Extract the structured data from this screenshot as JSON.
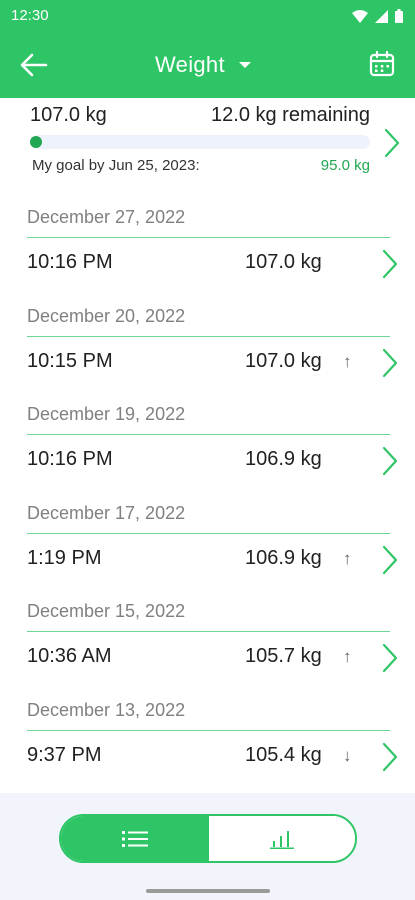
{
  "status_bar": {
    "time": "12:30"
  },
  "app_bar": {
    "title": "Weight"
  },
  "summary": {
    "current_weight": "107.0 kg",
    "remaining": "12.0 kg remaining",
    "goal_label": "My goal by  Jun 25, 2023:",
    "goal_weight": "95.0 kg",
    "progress_fraction": 0.0
  },
  "entries": [
    {
      "date": "December 27, 2022",
      "time": "10:16 PM",
      "weight": "107.0 kg",
      "trend": ""
    },
    {
      "date": "December 20, 2022",
      "time": "10:15 PM",
      "weight": "107.0 kg",
      "trend": "↑"
    },
    {
      "date": "December 19, 2022",
      "time": "10:16 PM",
      "weight": "106.9 kg",
      "trend": ""
    },
    {
      "date": "December 17, 2022",
      "time": "1:19 PM",
      "weight": "106.9 kg",
      "trend": "↑"
    },
    {
      "date": "December 15, 2022",
      "time": "10:36 AM",
      "weight": "105.7 kg",
      "trend": "↑"
    },
    {
      "date": "December 13, 2022",
      "time": "9:37 PM",
      "weight": "105.4 kg",
      "trend": "↓"
    }
  ],
  "view_toggle": {
    "selected": "list",
    "options": [
      "list-icon",
      "chart-icon"
    ]
  },
  "colors": {
    "accent": "#2ec566",
    "goal_text": "#22a852",
    "bottom_bg": "#f1f4fb"
  }
}
